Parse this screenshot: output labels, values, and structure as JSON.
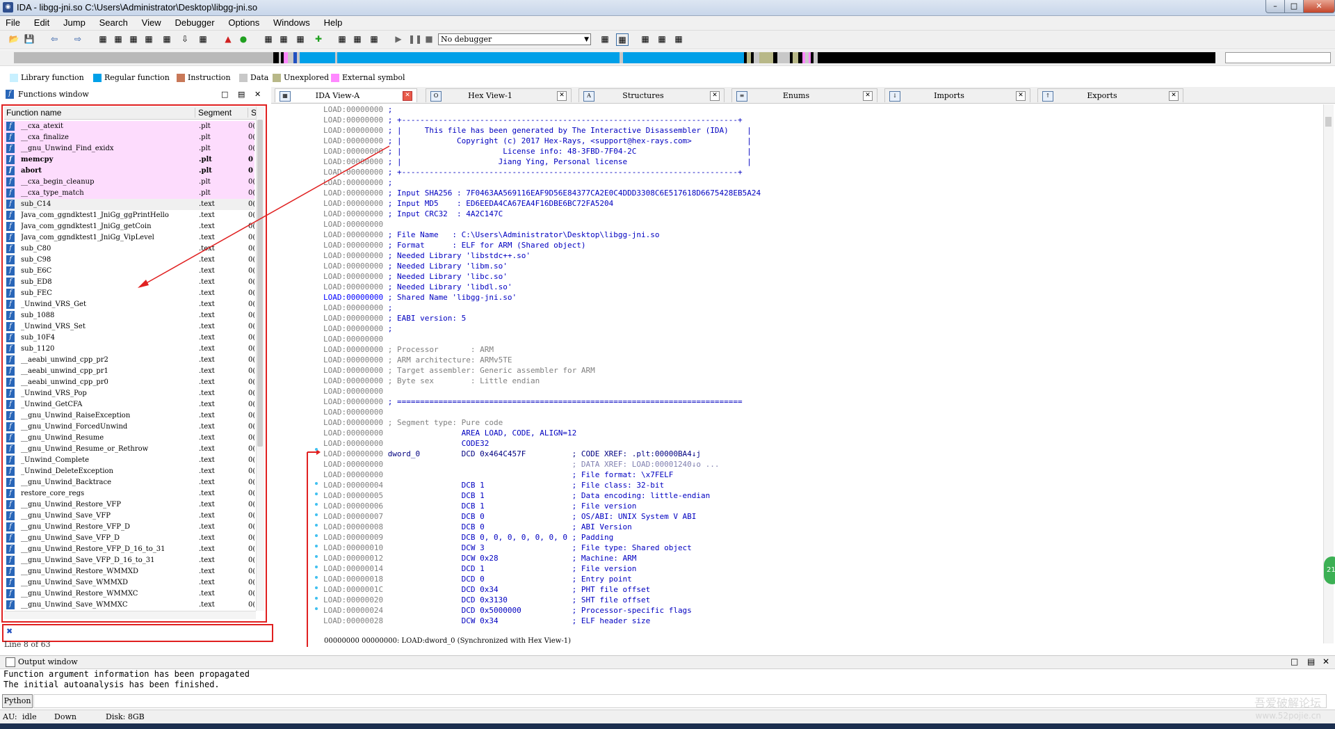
{
  "window": {
    "title": "IDA - libgg-jni.so C:\\Users\\Administrator\\Desktop\\libgg-jni.so"
  },
  "menu": [
    "File",
    "Edit",
    "Jump",
    "Search",
    "View",
    "Debugger",
    "Options",
    "Windows",
    "Help"
  ],
  "toolbar": {
    "debugger": "No debugger"
  },
  "legend": [
    {
      "label": "Library function",
      "color": "#c8f0ff"
    },
    {
      "label": "Regular function",
      "color": "#00a0e8"
    },
    {
      "label": "Instruction",
      "color": "#c87858"
    },
    {
      "label": "Data",
      "color": "#c8c8c8"
    },
    {
      "label": "Unexplored",
      "color": "#b8b888"
    },
    {
      "label": "External symbol",
      "color": "#ff88ff"
    }
  ],
  "functions_window": {
    "title": "Functions window",
    "col_name": "Function name",
    "col_segment": "Segment",
    "col_extra": "S",
    "status": "Line 8 of 63",
    "rows": [
      {
        "name": "__cxa_atexit",
        "seg": ".plt",
        "s": "0(",
        "type": "plt"
      },
      {
        "name": "__cxa_finalize",
        "seg": ".plt",
        "s": "0(",
        "type": "plt"
      },
      {
        "name": "__gnu_Unwind_Find_exidx",
        "seg": ".plt",
        "s": "0(",
        "type": "plt"
      },
      {
        "name": "memcpy",
        "seg": ".plt",
        "s": "0",
        "type": "plt-bold"
      },
      {
        "name": "abort",
        "seg": ".plt",
        "s": "0",
        "type": "plt-bold"
      },
      {
        "name": "__cxa_begin_cleanup",
        "seg": ".plt",
        "s": "0(",
        "type": "plt"
      },
      {
        "name": "__cxa_type_match",
        "seg": ".plt",
        "s": "0(",
        "type": "plt"
      },
      {
        "name": "sub_C14",
        "seg": ".text",
        "s": "0(",
        "type": "sel"
      },
      {
        "name": "Java_com_ggndktest1_JniGg_ggPrintHello",
        "seg": ".text",
        "s": "0(",
        "type": ""
      },
      {
        "name": "Java_com_ggndktest1_JniGg_getCoin",
        "seg": ".text",
        "s": "0(",
        "type": ""
      },
      {
        "name": "Java_com_ggndktest1_JniGg_VipLevel",
        "seg": ".text",
        "s": "0(",
        "type": ""
      },
      {
        "name": "sub_C80",
        "seg": ".text",
        "s": "0(",
        "type": ""
      },
      {
        "name": "sub_C98",
        "seg": ".text",
        "s": "0(",
        "type": ""
      },
      {
        "name": "sub_E6C",
        "seg": ".text",
        "s": "0(",
        "type": ""
      },
      {
        "name": "sub_ED8",
        "seg": ".text",
        "s": "0(",
        "type": ""
      },
      {
        "name": "sub_FEC",
        "seg": ".text",
        "s": "0(",
        "type": ""
      },
      {
        "name": "_Unwind_VRS_Get",
        "seg": ".text",
        "s": "0(",
        "type": ""
      },
      {
        "name": "sub_1088",
        "seg": ".text",
        "s": "0(",
        "type": ""
      },
      {
        "name": "_Unwind_VRS_Set",
        "seg": ".text",
        "s": "0(",
        "type": ""
      },
      {
        "name": "sub_10F4",
        "seg": ".text",
        "s": "0(",
        "type": ""
      },
      {
        "name": "sub_1120",
        "seg": ".text",
        "s": "0(",
        "type": ""
      },
      {
        "name": "__aeabi_unwind_cpp_pr2",
        "seg": ".text",
        "s": "0(",
        "type": ""
      },
      {
        "name": "__aeabi_unwind_cpp_pr1",
        "seg": ".text",
        "s": "0(",
        "type": ""
      },
      {
        "name": "__aeabi_unwind_cpp_pr0",
        "seg": ".text",
        "s": "0(",
        "type": ""
      },
      {
        "name": "_Unwind_VRS_Pop",
        "seg": ".text",
        "s": "0(",
        "type": ""
      },
      {
        "name": "_Unwind_GetCFA",
        "seg": ".text",
        "s": "0(",
        "type": ""
      },
      {
        "name": "__gnu_Unwind_RaiseException",
        "seg": ".text",
        "s": "0(",
        "type": ""
      },
      {
        "name": "__gnu_Unwind_ForcedUnwind",
        "seg": ".text",
        "s": "0(",
        "type": ""
      },
      {
        "name": "__gnu_Unwind_Resume",
        "seg": ".text",
        "s": "0(",
        "type": ""
      },
      {
        "name": "__gnu_Unwind_Resume_or_Rethrow",
        "seg": ".text",
        "s": "0(",
        "type": ""
      },
      {
        "name": "_Unwind_Complete",
        "seg": ".text",
        "s": "0(",
        "type": ""
      },
      {
        "name": "_Unwind_DeleteException",
        "seg": ".text",
        "s": "0(",
        "type": ""
      },
      {
        "name": "__gnu_Unwind_Backtrace",
        "seg": ".text",
        "s": "0(",
        "type": ""
      },
      {
        "name": "restore_core_regs",
        "seg": ".text",
        "s": "0(",
        "type": ""
      },
      {
        "name": "__gnu_Unwind_Restore_VFP",
        "seg": ".text",
        "s": "0(",
        "type": ""
      },
      {
        "name": "__gnu_Unwind_Save_VFP",
        "seg": ".text",
        "s": "0(",
        "type": ""
      },
      {
        "name": "__gnu_Unwind_Restore_VFP_D",
        "seg": ".text",
        "s": "0(",
        "type": ""
      },
      {
        "name": "__gnu_Unwind_Save_VFP_D",
        "seg": ".text",
        "s": "0(",
        "type": ""
      },
      {
        "name": "__gnu_Unwind_Restore_VFP_D_16_to_31",
        "seg": ".text",
        "s": "0(",
        "type": ""
      },
      {
        "name": "__gnu_Unwind_Save_VFP_D_16_to_31",
        "seg": ".text",
        "s": "0(",
        "type": ""
      },
      {
        "name": "__gnu_Unwind_Restore_WMMXD",
        "seg": ".text",
        "s": "0(",
        "type": ""
      },
      {
        "name": "__gnu_Unwind_Save_WMMXD",
        "seg": ".text",
        "s": "0(",
        "type": ""
      },
      {
        "name": "__gnu_Unwind_Restore_WMMXC",
        "seg": ".text",
        "s": "0(",
        "type": ""
      },
      {
        "name": "__gnu_Unwind_Save_WMMXC",
        "seg": ".text",
        "s": "0(",
        "type": ""
      }
    ]
  },
  "tabs": [
    {
      "label": "IDA View-A",
      "active": true
    },
    {
      "label": "Hex View-1",
      "active": false
    },
    {
      "label": "Structures",
      "active": false
    },
    {
      "label": "Enums",
      "active": false
    },
    {
      "label": "Imports",
      "active": false
    },
    {
      "label": "Exports",
      "active": false
    }
  ],
  "disasm": {
    "status": "00000000 00000000: LOAD:dword_0 (Synchronized with Hex View-1)",
    "lines": [
      {
        "a": "LOAD:00000000",
        "t": " ;",
        "c": "b"
      },
      {
        "a": "LOAD:00000000",
        "t": " ; +-------------------------------------------------------------------------+",
        "c": "b"
      },
      {
        "a": "LOAD:00000000",
        "t": " ; |     This file has been generated by The Interactive Disassembler (IDA)    |",
        "c": "b"
      },
      {
        "a": "LOAD:00000000",
        "t": " ; |            Copyright (c) 2017 Hex-Rays, <support@hex-rays.com>            |",
        "c": "b"
      },
      {
        "a": "LOAD:00000000",
        "t": " ; |                      License info: 48-3FBD-7F04-2C                        |",
        "c": "b"
      },
      {
        "a": "LOAD:00000000",
        "t": " ; |                     Jiang Ying, Personal license                          |",
        "c": "b"
      },
      {
        "a": "LOAD:00000000",
        "t": " ; +-------------------------------------------------------------------------+",
        "c": "b"
      },
      {
        "a": "LOAD:00000000",
        "t": " ;",
        "c": "b"
      },
      {
        "a": "LOAD:00000000",
        "t": " ; Input SHA256 : 7F0463AA569116EAF9D56E84377CA2E0C4DDD3308C6E517618D6675428EB5A24",
        "c": "b"
      },
      {
        "a": "LOAD:00000000",
        "t": " ; Input MD5    : ED6EEDA4CA67EA4F16DBE6BC72FA5204",
        "c": "b"
      },
      {
        "a": "LOAD:00000000",
        "t": " ; Input CRC32  : 4A2C147C",
        "c": "b"
      },
      {
        "a": "LOAD:00000000",
        "t": "",
        "c": "b"
      },
      {
        "a": "LOAD:00000000",
        "t": " ; File Name   : C:\\Users\\Administrator\\Desktop\\libgg-jni.so",
        "c": "b"
      },
      {
        "a": "LOAD:00000000",
        "t": " ; Format      : ELF for ARM (Shared object)",
        "c": "b"
      },
      {
        "a": "LOAD:00000000",
        "t": " ; Needed Library 'libstdc++.so'",
        "c": "b"
      },
      {
        "a": "LOAD:00000000",
        "t": " ; Needed Library 'libm.so'",
        "c": "b"
      },
      {
        "a": "LOAD:00000000",
        "t": " ; Needed Library 'libc.so'",
        "c": "b"
      },
      {
        "a": "LOAD:00000000",
        "t": " ; Needed Library 'libdl.so'",
        "c": "b"
      },
      {
        "a": "LOAD:00000000",
        "t": " ; Shared Name 'libgg-jni.so'",
        "c": "b",
        "hl": true
      },
      {
        "a": "LOAD:00000000",
        "t": " ;",
        "c": "b"
      },
      {
        "a": "LOAD:00000000",
        "t": " ; EABI version: 5",
        "c": "b"
      },
      {
        "a": "LOAD:00000000",
        "t": " ;",
        "c": "b"
      },
      {
        "a": "LOAD:00000000",
        "t": "",
        "c": "b"
      },
      {
        "a": "LOAD:00000000",
        "t": " ; Processor       : ARM",
        "c": "g"
      },
      {
        "a": "LOAD:00000000",
        "t": " ; ARM architecture: ARMv5TE",
        "c": "g"
      },
      {
        "a": "LOAD:00000000",
        "t": " ; Target assembler: Generic assembler for ARM",
        "c": "g"
      },
      {
        "a": "LOAD:00000000",
        "t": " ; Byte sex        : Little endian",
        "c": "g"
      },
      {
        "a": "LOAD:00000000",
        "t": "",
        "c": "b"
      },
      {
        "a": "LOAD:00000000",
        "t": " ; ===========================================================================",
        "c": "b"
      },
      {
        "a": "LOAD:00000000",
        "t": "",
        "c": "b"
      },
      {
        "a": "LOAD:00000000",
        "t": " ; Segment type: Pure code",
        "c": "g"
      },
      {
        "a": "LOAD:00000000",
        "t": "                 AREA LOAD, CODE, ALIGN=12",
        "c": "b"
      },
      {
        "a": "LOAD:00000000",
        "t": "                 CODE32",
        "c": "b"
      },
      {
        "a": "LOAD:00000000",
        "t": " dword_0         DCD 0x464C457F          ; CODE XREF: .plt:00000BA4↓j",
        "c": "k"
      },
      {
        "a": "LOAD:00000000",
        "t": "                                         ; DATA XREF: LOAD:00001240↓o ...",
        "c": "d"
      },
      {
        "a": "LOAD:00000000",
        "t": "                                         ; File format: \\x7FELF",
        "c": "b"
      },
      {
        "a": "LOAD:00000004",
        "t": "                 DCB 1                   ; File class: 32-bit",
        "c": "b"
      },
      {
        "a": "LOAD:00000005",
        "t": "                 DCB 1                   ; Data encoding: little-endian",
        "c": "b"
      },
      {
        "a": "LOAD:00000006",
        "t": "                 DCB 1                   ; File version",
        "c": "b"
      },
      {
        "a": "LOAD:00000007",
        "t": "                 DCB 0                   ; OS/ABI: UNIX System V ABI",
        "c": "b"
      },
      {
        "a": "LOAD:00000008",
        "t": "                 DCB 0                   ; ABI Version",
        "c": "b"
      },
      {
        "a": "LOAD:00000009",
        "t": "                 DCB 0, 0, 0, 0, 0, 0, 0 ; Padding",
        "c": "b"
      },
      {
        "a": "LOAD:00000010",
        "t": "                 DCW 3                   ; File type: Shared object",
        "c": "b"
      },
      {
        "a": "LOAD:00000012",
        "t": "                 DCW 0x28                ; Machine: ARM",
        "c": "b"
      },
      {
        "a": "LOAD:00000014",
        "t": "                 DCD 1                   ; File version",
        "c": "b"
      },
      {
        "a": "LOAD:00000018",
        "t": "                 DCD 0                   ; Entry point",
        "c": "b"
      },
      {
        "a": "LOAD:0000001C",
        "t": "                 DCD 0x34                ; PHT file offset",
        "c": "b"
      },
      {
        "a": "LOAD:00000020",
        "t": "                 DCD 0x3130              ; SHT file offset",
        "c": "b"
      },
      {
        "a": "LOAD:00000024",
        "t": "                 DCD 0x5000000           ; Processor-specific flags",
        "c": "b"
      },
      {
        "a": "LOAD:00000028",
        "t": "                 DCW 0x34                ; ELF header size",
        "c": "b"
      }
    ]
  },
  "output_window": {
    "title": "Output window",
    "lines": [
      "Function argument information has been propagated",
      "The initial autoanalysis has been finished."
    ],
    "python_button": "Python"
  },
  "statusbar": {
    "au": "AU:",
    "state": "idle",
    "dir": "Down",
    "disk": "Disk: 8GB"
  },
  "watermark": {
    "line1": "吾爱破解论坛",
    "line2": "www.52pojie.cn"
  },
  "badge": "21"
}
